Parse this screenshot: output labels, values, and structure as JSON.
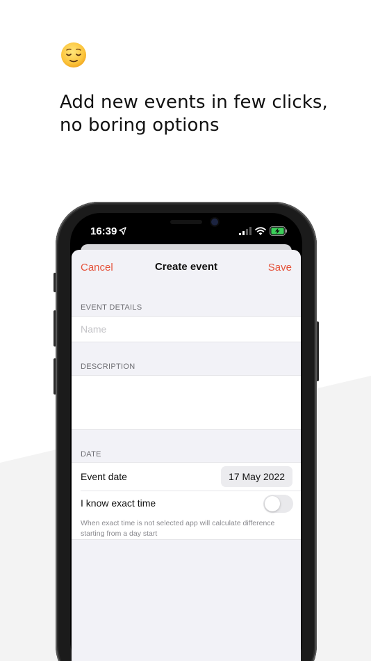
{
  "emoji": "relieved-face",
  "headline": {
    "line1": "Add new events in few clicks,",
    "line2": "no boring options"
  },
  "status_bar": {
    "time": "16:39",
    "location_icon": "location-arrow-icon",
    "signal_icon": "cellular-signal-icon",
    "wifi_icon": "wifi-icon",
    "battery_icon": "battery-charging-icon"
  },
  "nav": {
    "cancel": "Cancel",
    "title": "Create event",
    "save": "Save",
    "accent_color": "#e5533c"
  },
  "sections": {
    "event_details": "EVENT DETAILS",
    "description": "DESCRIPTION",
    "date": "DATE"
  },
  "fields": {
    "name_placeholder": "Name",
    "name_value": "",
    "description_value": ""
  },
  "date_section": {
    "event_date_label": "Event date",
    "event_date_value": "17 May 2022",
    "exact_time_label": "I know exact time",
    "exact_time_on": false,
    "hint": "When exact time is not selected app will calculate difference starting from a day start"
  }
}
